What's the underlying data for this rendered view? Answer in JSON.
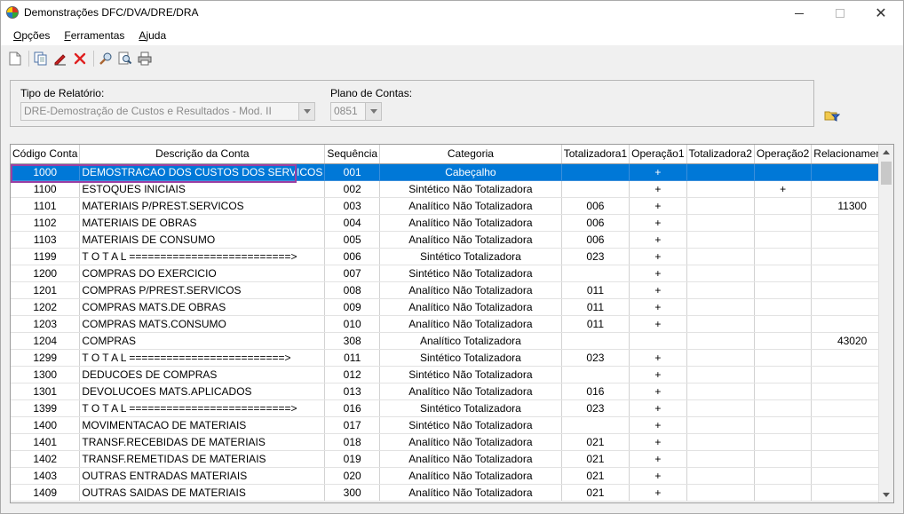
{
  "window": {
    "title": "Demonstrações DFC/DVA/DRE/DRA"
  },
  "menu": [
    {
      "label": "Opções",
      "underline": "O",
      "rest": "pções"
    },
    {
      "label": "Ferramentas",
      "underline": "F",
      "rest": "erramentas"
    },
    {
      "label": "Ajuda",
      "underline": "A",
      "rest": "juda"
    }
  ],
  "toolbar": {
    "icons": [
      "new-document-icon",
      "copy-icon",
      "edit-pencil-icon",
      "delete-icon",
      "search-icon",
      "find-icon",
      "print-icon"
    ]
  },
  "filters": {
    "report_type_label": "Tipo de Relatório:",
    "report_type_value": "DRE-Demostração de Custos e Resultados - Mod. II",
    "chart_of_accounts_label": "Plano de Contas:",
    "chart_of_accounts_value": "0851"
  },
  "grid": {
    "columns": [
      "Código Conta",
      "Descrição da Conta",
      "Sequência",
      "Categoria",
      "Totalizadora1",
      "Operação1",
      "Totalizadora2",
      "Operação2",
      "Relacionamento"
    ],
    "selected_row": 0,
    "rows": [
      [
        "1000",
        "DEMOSTRACAO DOS CUSTOS DOS SERVICOS",
        "001",
        "Cabeçalho",
        "",
        "+",
        "",
        "",
        ""
      ],
      [
        "1100",
        "ESTOQUES INICIAIS",
        "002",
        "Sintético Não Totalizadora",
        "",
        "+",
        "",
        "+",
        ""
      ],
      [
        "1101",
        "MATERIAIS P/PREST.SERVICOS",
        "003",
        "Analítico Não Totalizadora",
        "006",
        "+",
        "",
        "",
        "11300"
      ],
      [
        "1102",
        "MATERIAIS DE OBRAS",
        "004",
        "Analítico Não Totalizadora",
        "006",
        "+",
        "",
        "",
        ""
      ],
      [
        "1103",
        "MATERIAIS DE CONSUMO",
        "005",
        "Analítico Não Totalizadora",
        "006",
        "+",
        "",
        "",
        ""
      ],
      [
        "1199",
        "T O T A L ==========================>",
        "006",
        "Sintético Totalizadora",
        "023",
        "+",
        "",
        "",
        ""
      ],
      [
        "1200",
        "COMPRAS DO EXERCICIO",
        "007",
        "Sintético Não Totalizadora",
        "",
        "+",
        "",
        "",
        ""
      ],
      [
        "1201",
        "COMPRAS P/PREST.SERVICOS",
        "008",
        "Analítico Não Totalizadora",
        "011",
        "+",
        "",
        "",
        ""
      ],
      [
        "1202",
        "COMPRAS MATS.DE OBRAS",
        "009",
        "Analítico Não Totalizadora",
        "011",
        "+",
        "",
        "",
        ""
      ],
      [
        "1203",
        "COMPRAS MATS.CONSUMO",
        "010",
        "Analítico Não Totalizadora",
        "011",
        "+",
        "",
        "",
        ""
      ],
      [
        "1204",
        "COMPRAS",
        "308",
        "Analítico Totalizadora",
        "",
        "",
        "",
        "",
        "43020"
      ],
      [
        "1299",
        "T O T A L =========================>",
        "011",
        "Sintético Totalizadora",
        "023",
        "+",
        "",
        "",
        ""
      ],
      [
        "1300",
        "DEDUCOES DE COMPRAS",
        "012",
        "Sintético Não Totalizadora",
        "",
        "+",
        "",
        "",
        ""
      ],
      [
        "1301",
        "DEVOLUCOES MATS.APLICADOS",
        "013",
        "Analítico Não Totalizadora",
        "016",
        "+",
        "",
        "",
        ""
      ],
      [
        "1399",
        "T O T A L ==========================>",
        "016",
        "Sintético Totalizadora",
        "023",
        "+",
        "",
        "",
        ""
      ],
      [
        "1400",
        "MOVIMENTACAO DE MATERIAIS",
        "017",
        "Sintético Não Totalizadora",
        "",
        "+",
        "",
        "",
        ""
      ],
      [
        "1401",
        "TRANSF.RECEBIDAS DE MATERIAIS",
        "018",
        "Analítico Não Totalizadora",
        "021",
        "+",
        "",
        "",
        ""
      ],
      [
        "1402",
        "TRANSF.REMETIDAS DE MATERIAIS",
        "019",
        "Analítico Não Totalizadora",
        "021",
        "+",
        "",
        "",
        ""
      ],
      [
        "1403",
        "OUTRAS ENTRADAS MATERIAIS",
        "020",
        "Analítico Não Totalizadora",
        "021",
        "+",
        "",
        "",
        ""
      ],
      [
        "1409",
        "OUTRAS SAIDAS DE MATERIAIS",
        "300",
        "Analítico Não Totalizadora",
        "021",
        "+",
        "",
        "",
        ""
      ]
    ]
  }
}
